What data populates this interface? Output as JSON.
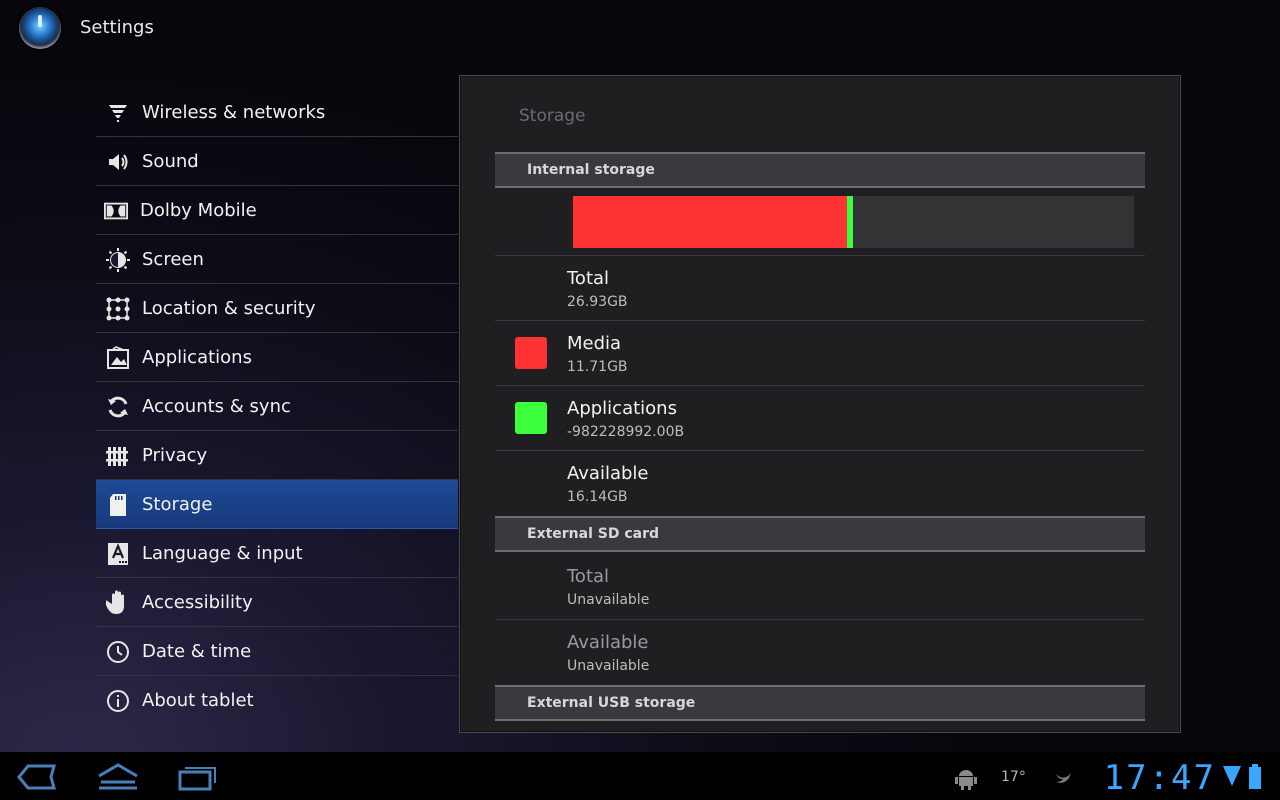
{
  "app": {
    "title": "Settings"
  },
  "sidebar": {
    "items": [
      {
        "label": "Wireless & networks",
        "icon": "wifi-icon"
      },
      {
        "label": "Sound",
        "icon": "speaker-icon"
      },
      {
        "label": "Dolby Mobile",
        "icon": "dolby-icon"
      },
      {
        "label": "Screen",
        "icon": "brightness-icon"
      },
      {
        "label": "Location & security",
        "icon": "lock-pattern-icon"
      },
      {
        "label": "Applications",
        "icon": "applications-icon"
      },
      {
        "label": "Accounts & sync",
        "icon": "sync-icon"
      },
      {
        "label": "Privacy",
        "icon": "privacy-icon"
      },
      {
        "label": "Storage",
        "icon": "sdcard-icon",
        "selected": true
      },
      {
        "label": "Language & input",
        "icon": "language-icon"
      },
      {
        "label": "Accessibility",
        "icon": "hand-icon"
      },
      {
        "label": "Date & time",
        "icon": "clock-icon"
      },
      {
        "label": "About tablet",
        "icon": "info-icon"
      }
    ]
  },
  "storage": {
    "title": "Storage",
    "internal": {
      "header": "Internal storage",
      "bar": {
        "media_fraction": 0.488,
        "apps_fraction": 0.01
      },
      "rows": [
        {
          "title": "Total",
          "value": "26.93GB"
        },
        {
          "title": "Media",
          "value": "11.71GB",
          "color": "#ff3333"
        },
        {
          "title": "Applications",
          "value": "-982228992.00B",
          "color": "#3cff3c"
        },
        {
          "title": "Available",
          "value": "16.14GB"
        }
      ]
    },
    "sdcard": {
      "header": "External SD card",
      "rows": [
        {
          "title": "Total",
          "value": "Unavailable"
        },
        {
          "title": "Available",
          "value": "Unavailable"
        }
      ]
    },
    "usb": {
      "header": "External USB storage"
    }
  },
  "statusbar": {
    "temperature": "17°",
    "clock": "17:47"
  },
  "colors": {
    "accent": "#3aa6ff",
    "selected_bg": "#1e4a96"
  }
}
